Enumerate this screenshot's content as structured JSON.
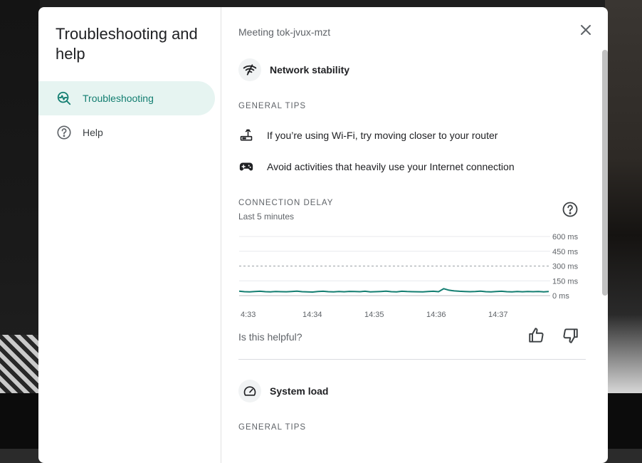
{
  "sidebar": {
    "title": "Troubleshooting and help",
    "items": [
      {
        "label": "Troubleshooting",
        "icon": "network-health-icon",
        "active": true
      },
      {
        "label": "Help",
        "icon": "help-circle-icon",
        "active": false
      }
    ]
  },
  "header": {
    "meeting": "Meeting tok-jvux-mzt",
    "close_icon": "close-icon"
  },
  "network": {
    "title": "Network stability",
    "icon": "wifi-off-icon",
    "tips_heading": "GENERAL TIPS",
    "tips": [
      {
        "icon": "router-icon",
        "text": "If you’re using Wi-Fi, try moving closer to your router"
      },
      {
        "icon": "gamepad-icon",
        "text": "Avoid activities that heavily use your Internet connection"
      }
    ]
  },
  "delay": {
    "heading": "CONNECTION DELAY",
    "subtitle": "Last 5 minutes",
    "help_icon": "help-circle-icon"
  },
  "chart_data": {
    "type": "line",
    "title": "CONNECTION DELAY",
    "subtitle": "Last 5 minutes",
    "x_ticks": [
      "4:33",
      "14:34",
      "14:35",
      "14:36",
      "14:37"
    ],
    "y_ticks": [
      "600 ms",
      "450 ms",
      "300 ms",
      "150 ms",
      "0 ms"
    ],
    "ylim": [
      0,
      600
    ],
    "threshold": 300,
    "series": [
      {
        "color": "#137e71",
        "values": [
          45,
          40,
          38,
          42,
          44,
          40,
          38,
          41,
          40,
          39,
          42,
          45,
          40,
          38,
          36,
          42,
          44,
          40,
          38,
          41,
          39,
          43,
          42,
          40,
          44,
          38,
          40,
          42,
          45,
          40,
          38,
          44,
          41,
          40,
          39,
          38,
          42,
          44,
          40,
          70,
          55,
          48,
          44,
          42,
          40,
          41,
          45,
          40,
          38,
          42,
          44,
          40,
          38,
          42,
          39,
          41,
          40,
          42,
          38,
          41
        ]
      }
    ],
    "grid": true
  },
  "feedback": {
    "question": "Is this helpful?",
    "up_icon": "thumb-up-icon",
    "down_icon": "thumb-down-icon"
  },
  "system": {
    "title": "System load",
    "icon": "speedometer-icon",
    "tips_heading": "GENERAL TIPS"
  },
  "colors": {
    "accent": "#137e71",
    "active_bg": "#e6f4f1"
  }
}
